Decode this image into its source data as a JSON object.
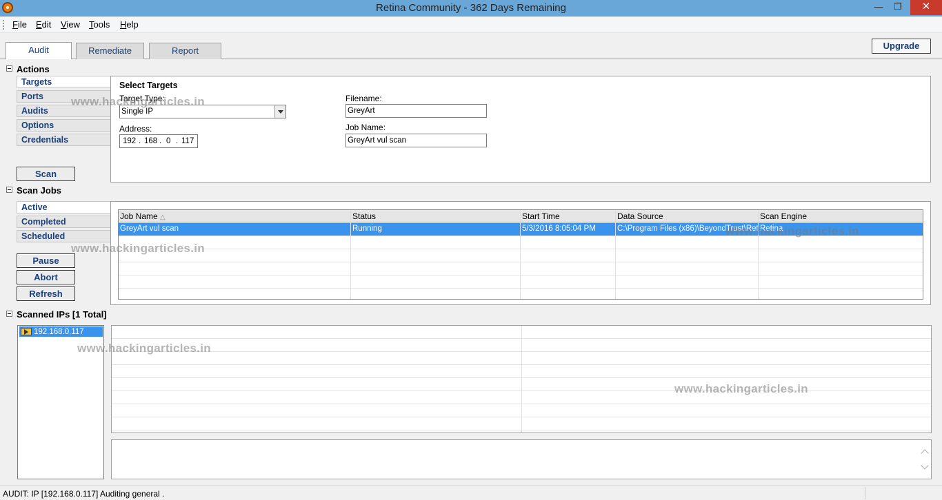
{
  "window": {
    "title": "Retina Community - 362  Days Remaining",
    "min": "—",
    "max": "❐",
    "close": "✕"
  },
  "menu": [
    "File",
    "Edit",
    "View",
    "Tools",
    "Help"
  ],
  "tabs": [
    "Audit",
    "Remediate",
    "Report"
  ],
  "upgrade_label": "Upgrade",
  "actions": {
    "header": "Actions",
    "items": [
      "Targets",
      "Ports",
      "Audits",
      "Options",
      "Credentials"
    ],
    "scan_label": "Scan"
  },
  "select_targets": {
    "title": "Select Targets",
    "target_type_label": "Target Type:",
    "target_type_value": "Single IP",
    "address_label": "Address:",
    "address_octets": [
      "192",
      "168",
      "0",
      "117"
    ],
    "filename_label": "Filename:",
    "filename_value": "GreyArt",
    "jobname_label": "Job Name:",
    "jobname_value": "GreyArt vul scan"
  },
  "scan_jobs": {
    "header": "Scan Jobs",
    "items": [
      "Active",
      "Completed",
      "Scheduled"
    ],
    "buttons": [
      "Pause",
      "Abort",
      "Refresh"
    ],
    "columns": [
      "Job Name",
      "Status",
      "Start Time",
      "Data Source",
      "Scan Engine"
    ],
    "sort_arrow": "△",
    "rows": [
      [
        "GreyArt vul scan",
        "Running",
        "5/3/2016 8:05:04 PM",
        "C:\\Program Files (x86)\\BeyondTrust\\Reti...",
        "Retina"
      ]
    ]
  },
  "scanned_ips": {
    "header": "Scanned IPs [1 Total]",
    "items": [
      "192.168.0.117"
    ]
  },
  "watermark": "www.hackingarticles.in",
  "status_text": "AUDIT: IP [192.168.0.117] Auditing general ."
}
